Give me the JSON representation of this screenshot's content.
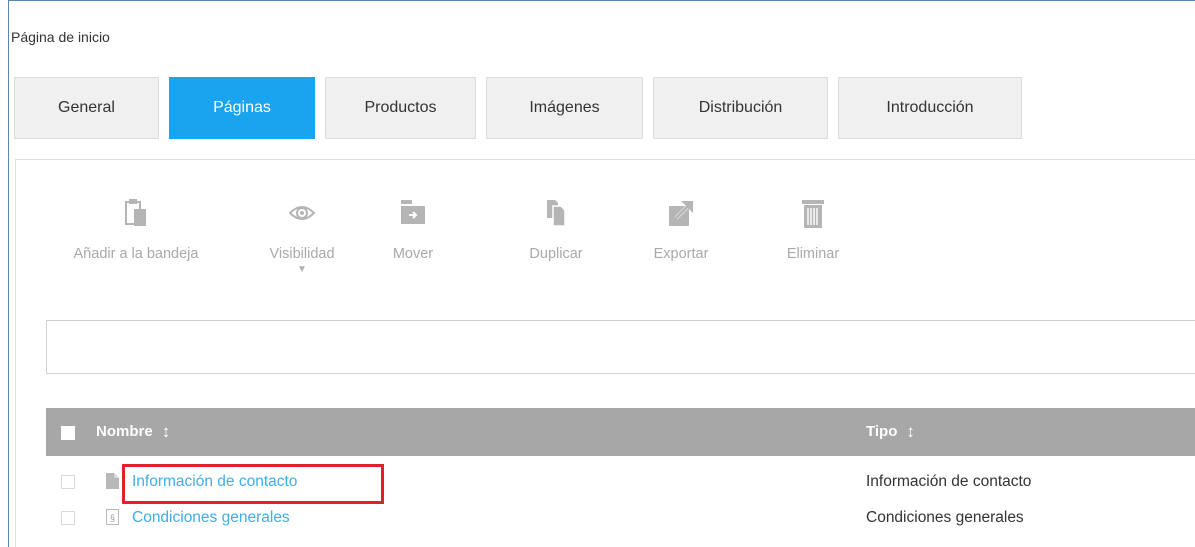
{
  "breadcrumb": "Página de inicio",
  "tabs": [
    {
      "label": "General",
      "active": false
    },
    {
      "label": "Páginas",
      "active": true
    },
    {
      "label": "Productos",
      "active": false
    },
    {
      "label": "Imágenes",
      "active": false
    },
    {
      "label": "Distribución",
      "active": false
    },
    {
      "label": "Introducción",
      "active": false
    }
  ],
  "toolbar": {
    "add_to_tray": {
      "label": "Añadir a la bandeja",
      "icon": "clipboard-icon"
    },
    "visibility": {
      "label": "Visibilidad",
      "icon": "eye-icon",
      "caret": "▼"
    },
    "move": {
      "label": "Mover",
      "icon": "folder-move-icon"
    },
    "duplicate": {
      "label": "Duplicar",
      "icon": "duplicate-icon"
    },
    "export": {
      "label": "Exportar",
      "icon": "export-icon"
    },
    "delete": {
      "label": "Eliminar",
      "icon": "trash-icon"
    }
  },
  "search": {
    "placeholder": ""
  },
  "table": {
    "columns": {
      "name": "Nombre",
      "type": "Tipo"
    },
    "rows": [
      {
        "name": "Información de contacto",
        "type": "Información de contacto",
        "icon": "document-icon",
        "highlighted": true
      },
      {
        "name": "Condiciones generales",
        "type": "Condiciones generales",
        "icon": "legal-document-icon",
        "highlighted": false
      }
    ]
  },
  "colors": {
    "active_tab": "#1aa3ef",
    "link": "#40aee8",
    "table_header": "#a7a7a7",
    "highlight": "#e0202a",
    "disabled": "#a9a9a9"
  }
}
